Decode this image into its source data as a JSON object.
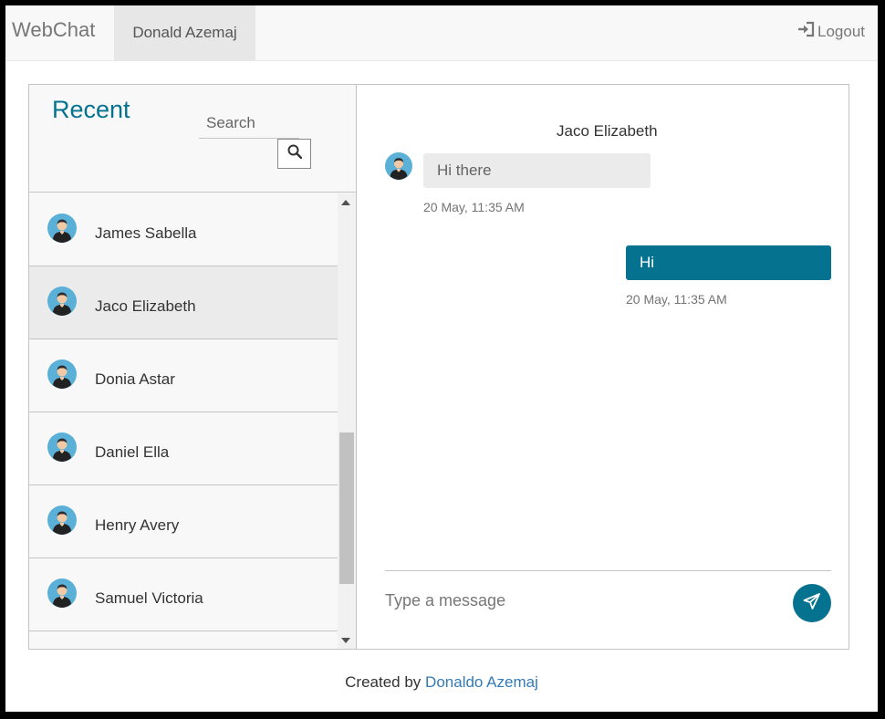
{
  "navbar": {
    "brand": "WebChat",
    "user": "Donald Azemaj",
    "logout": "Logout"
  },
  "sidebar": {
    "title": "Recent",
    "search_placeholder": "Search",
    "contacts": [
      {
        "name": "James Sabella",
        "active": false
      },
      {
        "name": "Jaco Elizabeth",
        "active": true
      },
      {
        "name": "Donia Astar",
        "active": false
      },
      {
        "name": "Daniel Ella",
        "active": false
      },
      {
        "name": "Henry Avery",
        "active": false
      },
      {
        "name": "Samuel Victoria",
        "active": false
      }
    ]
  },
  "chat": {
    "contact_name": "Jaco Elizabeth",
    "messages": [
      {
        "direction": "incoming",
        "text": "Hi there",
        "time": "20 May, 11:35 AM"
      },
      {
        "direction": "outgoing",
        "text": "Hi",
        "time": "20 May, 11:35 AM"
      }
    ],
    "input_placeholder": "Type a message"
  },
  "footer": {
    "prefix": "Created by",
    "author": "Donaldo Azemaj"
  },
  "colors": {
    "accent": "#05728f",
    "link": "#337ab7",
    "active_row": "#ebebeb"
  },
  "icons": {
    "logout": "sign-in-icon",
    "search": "search-icon",
    "send": "paper-plane-icon",
    "avatar": "user-avatar-icon"
  }
}
